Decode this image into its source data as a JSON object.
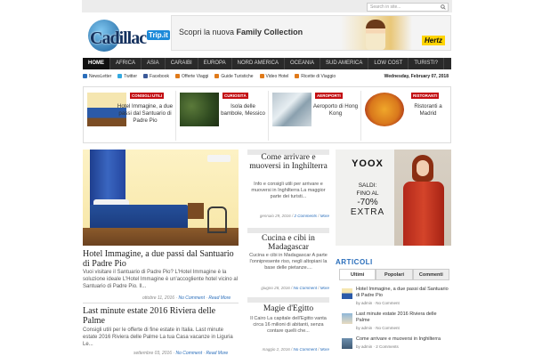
{
  "search": {
    "placeholder": "Search in site..."
  },
  "logo": {
    "word": "Cadillac",
    "badge": "Trip.it"
  },
  "banner": {
    "text_prefix": "Scopri la nuova ",
    "text_bold": "Family Collection",
    "brand": "Hertz"
  },
  "nav": [
    "Home",
    "Africa",
    "Asia",
    "Caraibi",
    "Europa",
    "Nord America",
    "Oceania",
    "Sud America",
    "Low Cost",
    "Turisti?"
  ],
  "subnav": [
    {
      "label": "NewsLetter",
      "color": "#2a6ebb"
    },
    {
      "label": "Twitter",
      "color": "#34a9e0"
    },
    {
      "label": "Facebook",
      "color": "#3b5998"
    },
    {
      "label": "Offerte Viaggi",
      "color": "#e07a1a"
    },
    {
      "label": "Guide Turistiche",
      "color": "#e07a1a"
    },
    {
      "label": "Video Hotel",
      "color": "#e07a1a"
    },
    {
      "label": "Ricette di Viaggio",
      "color": "#e07a1a"
    }
  ],
  "date": "Wednesday, February 07, 2018",
  "featured": [
    {
      "tag": "Consigli utili",
      "title": "Hotel Immagine, a due passi dal Santuario di Padre Pio"
    },
    {
      "tag": "Curiosità",
      "title": "Isola delle bambole, Messico"
    },
    {
      "tag": "Aeroporti",
      "title": "Aeroporto di Hong Kong"
    },
    {
      "tag": "Ristoranti",
      "title": "Ristoranti a Madrid"
    }
  ],
  "posts": [
    {
      "title": "Hotel Immagine, a due passi dal Santuario di Padre Pio",
      "text": "Vuoi visitare il Santuario di Padre Pio? L'Hotel Immagine è la soluzione ideale L'Hotel Immagine è un'accogliente hotel vicino al Santuario di Padre Pio. Il...",
      "date": "ottobre 11, 2016 · ",
      "comments": "No Comment",
      "more": "Read More"
    },
    {
      "title": "Last minute estate 2016 Riviera delle Palme",
      "text": "Consigli utili per le offerte di fine estate in Italia. Last minute estate 2016 Riviera delle Palme La tua Casa vacanze in Liguria Le...",
      "date": "settembre 03, 2016 · ",
      "comments": "No Comment",
      "more": "Read More"
    }
  ],
  "mid_posts": [
    {
      "title": "Come arrivare e muoversi in Inghilterra",
      "text": "Info e consigli utili per arrivare e muoversi in Inghilterra La maggior parte dei turisti...",
      "date": "gennaio 29, 2016 / ",
      "comments": "2 Comments",
      "more": "More"
    },
    {
      "title": "Cucina e cibi in Madagascar",
      "text": "Cucina e cibi in Madagascar A parte l'onnipresente riso, negli altopiani la base delle pietanze....",
      "date": "giugno 28, 2016 / ",
      "comments": "No Comment",
      "more": "More"
    },
    {
      "title": "Magie d'Egitto",
      "text": "Il Cairo La capitale dell'Egitto vanta circa 16 milioni di abitanti, senza contare quelli che...",
      "date": "maggio 2, 2016 / ",
      "comments": "No Comment",
      "more": "More"
    }
  ],
  "ad": {
    "brand": "YOOX",
    "saldi": "SALDI:",
    "fino": "FINO AL",
    "pct": "-70%",
    "extra": "EXTRA"
  },
  "sidebar": {
    "heading": "ARTICOLI",
    "tabs": [
      "Ultimi",
      "Popolari",
      "Commenti"
    ],
    "items": [
      {
        "title": "Hotel Immagine, a due passi dal Santuario di Padre Pio",
        "meta": "by admin · No Comment"
      },
      {
        "title": "Last minute estate 2016 Riviera delle Palme",
        "meta": "by admin · No Comment"
      },
      {
        "title": "Come arrivare e muoversi in Inghilterra",
        "meta": "by admin · 2 Comments"
      }
    ]
  }
}
